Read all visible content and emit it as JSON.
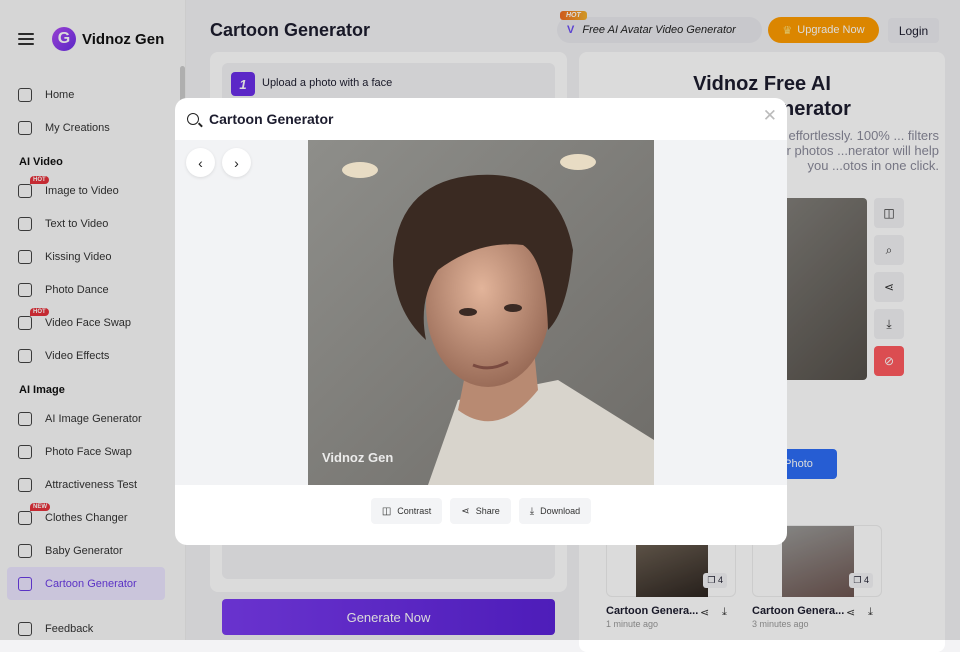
{
  "brand": {
    "name": "Vidnoz Gen",
    "logo_letter": "G"
  },
  "sidebar": {
    "items_top": [
      {
        "label": "Home"
      },
      {
        "label": "My Creations"
      }
    ],
    "sections": [
      {
        "title": "AI Video",
        "items": [
          {
            "label": "Image to Video",
            "badge": "HOT"
          },
          {
            "label": "Text to Video"
          },
          {
            "label": "Kissing Video"
          },
          {
            "label": "Photo Dance"
          },
          {
            "label": "Video Face Swap",
            "badge": "HOT"
          },
          {
            "label": "Video Effects"
          }
        ]
      },
      {
        "title": "AI Image",
        "items": [
          {
            "label": "AI Image Generator"
          },
          {
            "label": "Photo Face Swap"
          },
          {
            "label": "Attractiveness Test"
          },
          {
            "label": "Clothes Changer",
            "badge": "NEW"
          },
          {
            "label": "Baby Generator"
          },
          {
            "label": "Cartoon Generator",
            "active": true
          }
        ]
      }
    ],
    "feedback": "Feedback"
  },
  "header": {
    "title": "Cartoon Generator",
    "hot_tag": "HOT",
    "promo": "Free AI Avatar Video Generator",
    "upgrade": "Upgrade Now",
    "login": "Login"
  },
  "left": {
    "step_num": "1",
    "step_text": "Upload a photo with a face",
    "generate": "Generate Now"
  },
  "right": {
    "title": "Vidnoz Free AI Cartoon Generator",
    "desc": "...line effortlessly. 100% ... filters to your photos ...nerator will help you ...otos in one click.",
    "change": "g Photo",
    "cards": [
      {
        "title": "Cartoon Genera...",
        "time": "1 minute ago",
        "count": "4"
      },
      {
        "title": "Cartoon Genera...",
        "time": "3 minutes ago",
        "count": "4"
      }
    ]
  },
  "modal": {
    "title": "Cartoon Generator",
    "watermark": "Vidnoz Gen",
    "actions": [
      {
        "label": "Contrast",
        "icon": "compare-icon"
      },
      {
        "label": "Share",
        "icon": "share-icon"
      },
      {
        "label": "Download",
        "icon": "download-icon"
      }
    ]
  }
}
